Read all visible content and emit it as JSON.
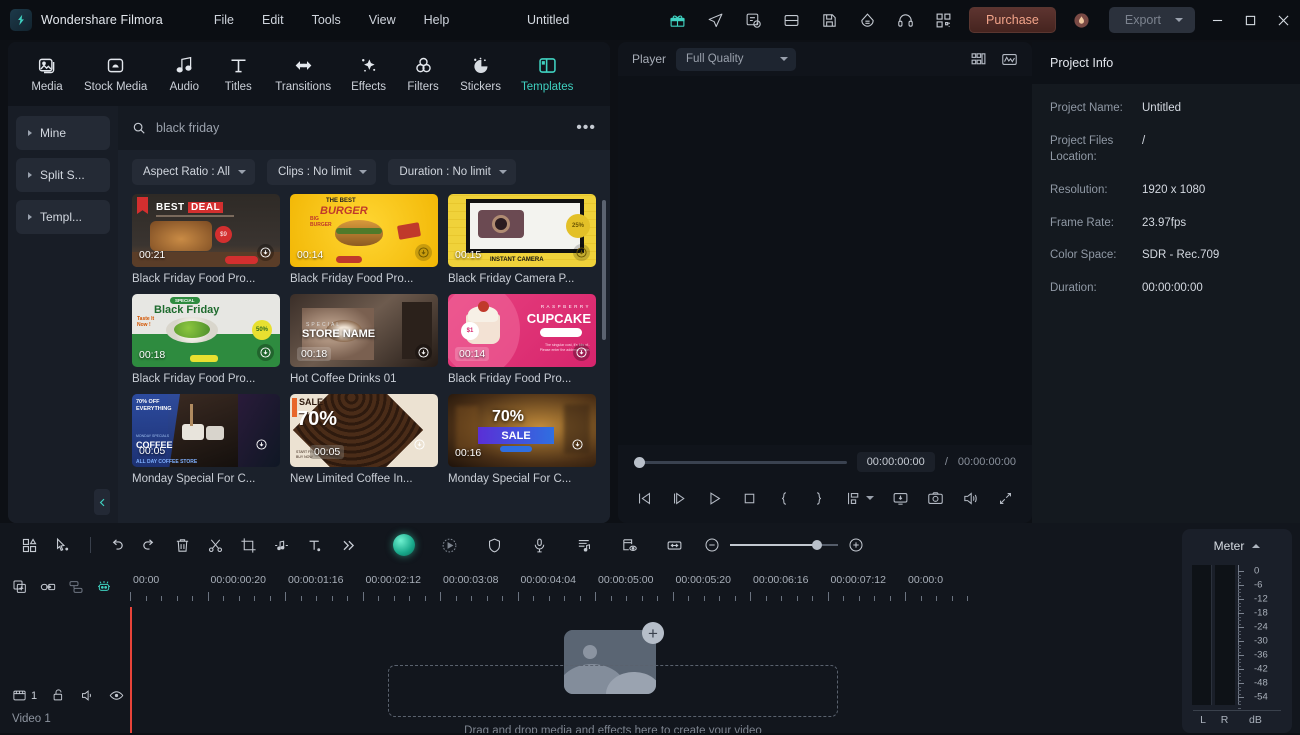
{
  "titlebar": {
    "brand": "Wondershare Filmora",
    "menus": [
      "File",
      "Edit",
      "Tools",
      "View",
      "Help"
    ],
    "doc_title": "Untitled",
    "icons": [
      "gift-icon",
      "send-icon",
      "notes-icon",
      "layout-icon",
      "save-icon",
      "cloud-icon",
      "headset-icon",
      "qrcode-icon"
    ],
    "purchase_label": "Purchase",
    "export_label": "Export",
    "accent": "#3fd1c0",
    "purchase_text_color": "#f2a48a"
  },
  "media_panel": {
    "tabs": [
      {
        "label": "Media",
        "icon": "media-icon",
        "active": false
      },
      {
        "label": "Stock Media",
        "icon": "stock-media-icon",
        "active": false
      },
      {
        "label": "Audio",
        "icon": "audio-icon",
        "active": false
      },
      {
        "label": "Titles",
        "icon": "titles-icon",
        "active": false
      },
      {
        "label": "Transitions",
        "icon": "transitions-icon",
        "active": false
      },
      {
        "label": "Effects",
        "icon": "effects-icon",
        "active": false
      },
      {
        "label": "Filters",
        "icon": "filters-icon",
        "active": false
      },
      {
        "label": "Stickers",
        "icon": "stickers-icon",
        "active": false
      },
      {
        "label": "Templates",
        "icon": "templates-icon",
        "active": true
      }
    ],
    "sidebar": [
      "Mine",
      "Split S...",
      "Templ..."
    ],
    "search": {
      "value": "black friday",
      "placeholder": "Search"
    },
    "filters": [
      "Aspect Ratio : All",
      "Clips : No limit",
      "Duration : No limit"
    ],
    "more_label": "•••",
    "templates": [
      {
        "title": "Black Friday Food Pro...",
        "duration": "00:21",
        "style": "bestdeal"
      },
      {
        "title": "Black Friday Food Pro...",
        "duration": "00:14",
        "style": "burger"
      },
      {
        "title": "Black Friday Camera P...",
        "duration": "00:15",
        "style": "camera"
      },
      {
        "title": "Black Friday Food Pro...",
        "duration": "00:18",
        "style": "salad"
      },
      {
        "title": "Hot Coffee Drinks 01",
        "duration": "00:18",
        "style": "coffeehand"
      },
      {
        "title": "Black Friday Food Pro...",
        "duration": "00:14",
        "style": "cupcake"
      },
      {
        "title": "Monday Special For C...",
        "duration": "00:05",
        "style": "coffeepour"
      },
      {
        "title": "New Limited Coffee In...",
        "duration": "00:05",
        "style": "beans"
      },
      {
        "title": "Monday Special For C...",
        "duration": "00:16",
        "style": "sale70"
      }
    ]
  },
  "player": {
    "label": "Player",
    "quality": "Full Quality",
    "top_icons": [
      "grid-view-icon",
      "waveform-icon"
    ],
    "current_time": "00:00:00:00",
    "separator": "/",
    "total_time": "00:00:00:00",
    "controls": [
      "prev-frame-icon",
      "next-frame-icon",
      "play-icon",
      "stop-icon",
      "mark-in-icon",
      "mark-out-icon",
      "keyframe-icon",
      "chevron-down-icon",
      "screen-record-icon",
      "snapshot-icon",
      "volume-icon",
      "fullscreen-icon"
    ]
  },
  "project_info": {
    "title": "Project Info",
    "rows": [
      {
        "key": "Project Name:",
        "value": "Untitled"
      },
      {
        "key": "Project Files\nLocation:",
        "value": "/"
      },
      {
        "key": "Resolution:",
        "value": "1920 x 1080"
      },
      {
        "key": "Frame Rate:",
        "value": "23.97fps"
      },
      {
        "key": "Color Space:",
        "value": "SDR - Rec.709"
      },
      {
        "key": "Duration:",
        "value": "00:00:00:00"
      }
    ]
  },
  "timeline": {
    "toolbar_icons": [
      "grid-apps-icon",
      "select-tool-icon",
      "undo-icon",
      "redo-icon",
      "delete-icon",
      "split-icon",
      "crop-icon",
      "audio-detach-icon",
      "text-tool-icon",
      "more-tools-icon",
      "ai-orb-icon",
      "auto-reframe-icon",
      "shield-icon",
      "voiceover-icon",
      "marker-icon",
      "render-preview-icon",
      "fit-timeline-icon"
    ],
    "zoom_out_icon": "zoom-out-icon",
    "zoom_in_icon": "zoom-in-icon",
    "track_tool_icons": [
      "duplicate-track-icon",
      "link-track-icon",
      "group-track-icon",
      "keyframe-track-icon"
    ],
    "ruler_labels": [
      "00:00",
      "00:00:00:20",
      "00:00:01:16",
      "00:00:02:12",
      "00:00:03:08",
      "00:00:04:04",
      "00:00:05:00",
      "00:00:05:20",
      "00:00:06:16",
      "00:00:07:12",
      "00:00:0"
    ],
    "track": {
      "count": "1",
      "label": "Video 1",
      "icons": [
        "track-video-icon",
        "lock-icon",
        "mute-icon",
        "eye-icon"
      ]
    },
    "drop_text": "Drag and drop media and effects here to create your video",
    "playhead_color": "#e8443a"
  },
  "meter": {
    "title": "Meter",
    "scale": [
      "0",
      "-6",
      "-12",
      "-18",
      "-24",
      "-30",
      "-36",
      "-42",
      "-48",
      "-54"
    ],
    "channels": [
      "L",
      "R"
    ],
    "unit": "dB"
  }
}
